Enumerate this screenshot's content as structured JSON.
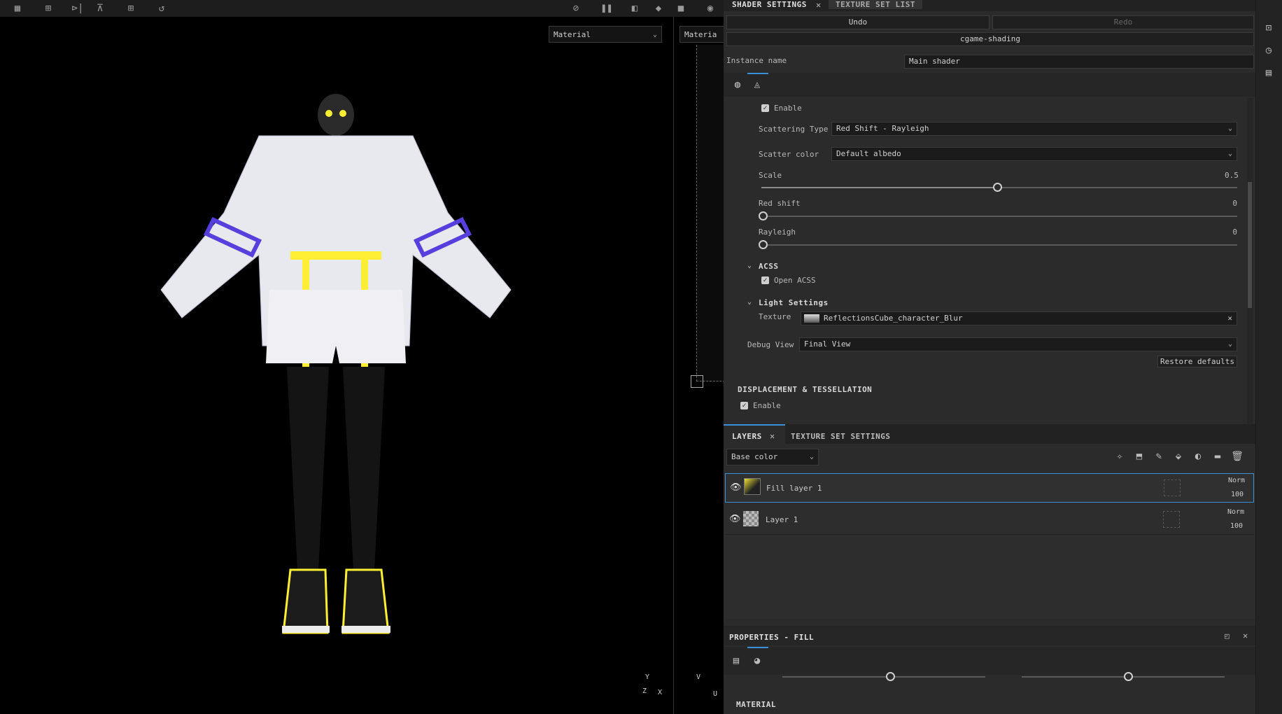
{
  "toolbar": {
    "icons": [
      "grid-icon",
      "grid-dropdown-icon",
      "mirror-icon",
      "symmetry-icon",
      "add-icon",
      "reset-icon",
      "hide-icon",
      "pause-icon",
      "camera-mode-icon",
      "cube-icon",
      "video-icon",
      "screenshot-icon"
    ]
  },
  "viewport": {
    "left_select": "Material",
    "right_select": "Materia",
    "axis_left": [
      "Y",
      "Z",
      "X"
    ],
    "axis_right": [
      "V",
      "U"
    ]
  },
  "shader": {
    "tab_label": "SHADER SETTINGS",
    "tab2_label": "TEXTURE SET LIST",
    "undo": "Undo",
    "redo": "Redo",
    "shader_name": "cgame-shading",
    "instance_label": "Instance name",
    "instance_value": "Main shader",
    "enable_label": "Enable",
    "scattering_type_label": "Scattering Type",
    "scattering_type_value": "Red Shift - Rayleigh",
    "scatter_color_label": "Scatter color",
    "scatter_color_value": "Default albedo",
    "scale_label": "Scale",
    "scale_value": "0.5",
    "red_shift_label": "Red shift",
    "red_shift_value": "0",
    "rayleigh_label": "Rayleigh",
    "rayleigh_value": "0",
    "acss_label": "ACSS",
    "open_acss_label": "Open ACSS",
    "light_settings_label": "Light Settings",
    "texture_label": "Texture",
    "texture_value": "ReflectionsCube_character_Blur",
    "debug_view_label": "Debug View",
    "debug_view_value": "Final View",
    "restore_label": "Restore defaults",
    "displacement_label": "DISPLACEMENT & TESSELLATION",
    "displacement_enable": "Enable"
  },
  "layers": {
    "tab_label": "LAYERS",
    "tab2_label": "TEXTURE SET SETTINGS",
    "channel_select": "Base color",
    "rows": [
      {
        "name": "Fill layer 1",
        "blend": "Norm",
        "opacity": "100"
      },
      {
        "name": "Layer 1",
        "blend": "Norm",
        "opacity": "100"
      }
    ]
  },
  "properties": {
    "title": "PROPERTIES - FILL",
    "material_label": "MATERIAL"
  },
  "colors": {
    "accent": "#3a8fd6",
    "panel": "#2b2b2b"
  }
}
